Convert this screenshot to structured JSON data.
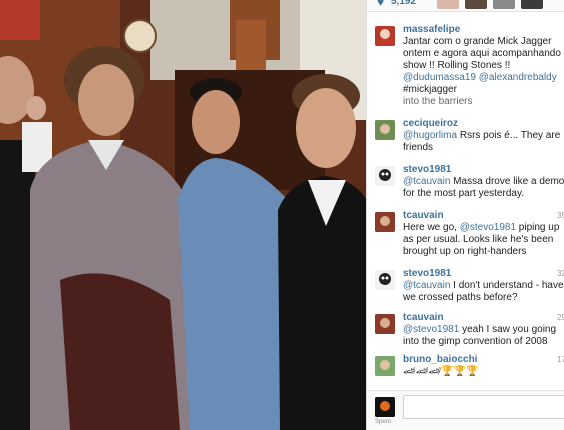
{
  "post": {
    "like_count": "5,192",
    "caption": {
      "user": "massafelipe",
      "text_lines": [
        "Jantar com o grande Mick Jagger",
        "ontem e agora aqui acompanhando",
        "show !! Rolling Stones !!"
      ],
      "mentions": "@dudumassa19 @alexandrebaldy",
      "hashtag": "#mickjagger"
    },
    "overflow_text": "into the barriers"
  },
  "comments": [
    {
      "user": "ceciqueiroz",
      "mention": "@hugorlima",
      "text": " Rsrs pois é... They are friends",
      "time": ""
    },
    {
      "user": "stevo1981",
      "mention": "@tcauvain",
      "text": " Massa drove like a demon for the most part yesterday.",
      "time": ""
    },
    {
      "user": "tcauvain",
      "mention": "",
      "text_pre": "Here we go, ",
      "mention_mid": "@stevo1981",
      "text": " piping up as per usual. Looks like he's been brought up on right-handers",
      "time": "35"
    },
    {
      "user": "stevo1981",
      "mention": "@tcauvain",
      "text": " I don't understand - have we crossed paths before?",
      "time": "32"
    },
    {
      "user": "tcauvain",
      "mention": "@stevo1981",
      "text": " yeah I saw you going into the gimp convention of 2008",
      "time": "29"
    },
    {
      "user": "bruno_baiocchi",
      "mention": "",
      "text": "🏎🏎🏎🏆🏆🏆",
      "time": "17"
    }
  ],
  "footer": {
    "placeholder": "",
    "app_label": "Spero"
  },
  "colors": {
    "link": "#3f729b",
    "text": "#222222"
  }
}
